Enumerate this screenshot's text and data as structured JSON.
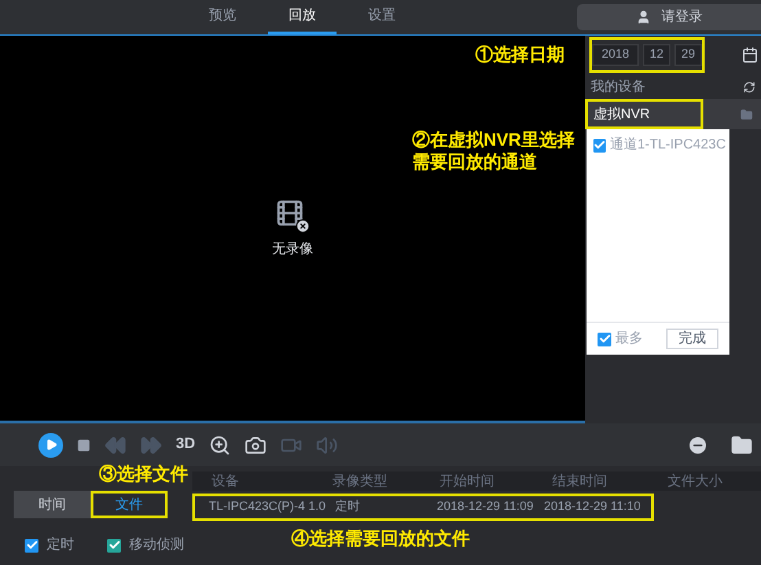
{
  "top_tabs": [
    {
      "label": "预览",
      "selected": false
    },
    {
      "label": "回放",
      "selected": true
    },
    {
      "label": "设置",
      "selected": false
    }
  ],
  "login_button": "请登录",
  "video": {
    "message": "无录像"
  },
  "date": {
    "year": "2018",
    "month": "12",
    "day": "29",
    "highlighted": true
  },
  "device_panel": {
    "title": "我的设备",
    "device": "虚拟NVR",
    "highlighted": true,
    "channels": [
      {
        "label": "通道1-TL-IPC423C",
        "checked": true
      }
    ],
    "multi": {
      "label": "最多",
      "checked": true
    },
    "done_button": "完成"
  },
  "speed_button": "3D",
  "mode_tabs": [
    {
      "label": "时间",
      "selected": false,
      "highlighted": false
    },
    {
      "label": "文件",
      "selected": true,
      "highlighted": true
    }
  ],
  "table": {
    "columns": [
      "设备",
      "录像类型",
      "开始时间",
      "结束时间",
      "文件大小"
    ],
    "rows": [
      {
        "cells": [
          "TL-IPC423C(P)-4 1.0",
          "定时",
          "2018-12-29 11:09",
          "2018-12-29 11:10"
        ],
        "highlighted": true
      }
    ]
  },
  "filters": [
    {
      "label": "定时",
      "checked": true,
      "color": "#2196f3"
    },
    {
      "label": "移动侦测",
      "checked": true,
      "color": "#26a69a"
    }
  ],
  "annotations": [
    {
      "text": "①选择日期"
    },
    {
      "text": "②在虚拟NVR里选择需要回放的通道"
    },
    {
      "text": "③选择文件"
    },
    {
      "text": "④选择需要回放的文件"
    }
  ]
}
